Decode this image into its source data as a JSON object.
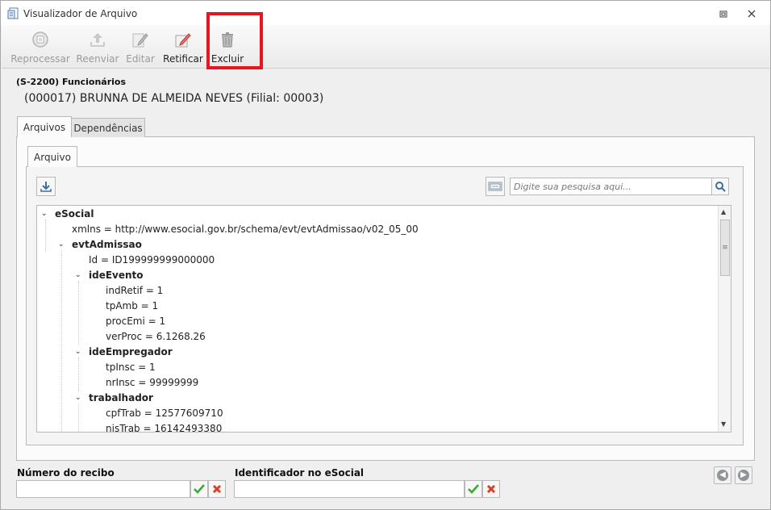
{
  "window": {
    "title": "Visualizador de Arquivo"
  },
  "toolbar": {
    "reprocessar": "Reprocessar",
    "reenviar": "Reenviar",
    "editar": "Editar",
    "retificar": "Retificar",
    "excluir": "Excluir"
  },
  "header": {
    "event": "(S-2200) Funcionários",
    "worker": "(000017) BRUNNA DE ALMEIDA NEVES (Filial: 00003)"
  },
  "tabs": {
    "arquivos": "Arquivos",
    "dependencias": "Dependências",
    "arquivo": "Arquivo"
  },
  "search": {
    "placeholder": "Digite sua pesquisa aqui..."
  },
  "tree": [
    {
      "text": "eSocial",
      "node": true
    },
    {
      "text": "xmlns = http://www.esocial.gov.br/schema/evt/evtAdmissao/v02_05_00",
      "node": false
    },
    {
      "text": "evtAdmissao",
      "node": true
    },
    {
      "text": "Id = ID199999999000000",
      "node": false
    },
    {
      "text": "ideEvento",
      "node": true
    },
    {
      "text": "indRetif = 1",
      "node": false
    },
    {
      "text": "tpAmb = 1",
      "node": false
    },
    {
      "text": "procEmi = 1",
      "node": false
    },
    {
      "text": "verProc = 6.1268.26",
      "node": false
    },
    {
      "text": "ideEmpregador",
      "node": true
    },
    {
      "text": "tpInsc = 1",
      "node": false
    },
    {
      "text": "nrInsc = 99999999",
      "node": false
    },
    {
      "text": "trabalhador",
      "node": true
    },
    {
      "text": "cpfTrab = 12577609710",
      "node": false
    },
    {
      "text": "nisTrab = 16142493380",
      "node": false
    }
  ],
  "footer": {
    "recibo_label": "Número do recibo",
    "recibo_value": "",
    "identificador_label": "Identificador no eSocial",
    "identificador_value": ""
  },
  "colors": {
    "highlight": "#e8141f",
    "accept": "#3aa935",
    "reject": "#d9401e"
  }
}
